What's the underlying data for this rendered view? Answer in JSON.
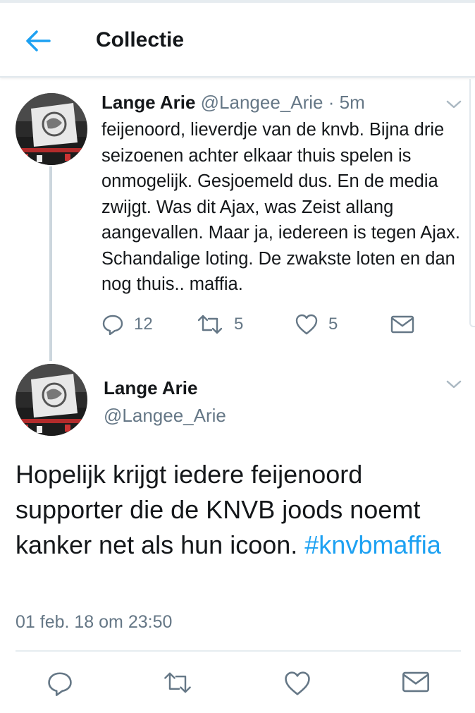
{
  "header": {
    "title": "Collectie",
    "back_icon": "arrow-left-icon",
    "accent_color": "#1da1f2"
  },
  "reply_tweet": {
    "name": "Lange Arie",
    "handle": "@Langee_Arie",
    "separator": "·",
    "time": "5m",
    "text": "feijenoord, lieverdje van de knvb. Bijna drie seizoenen achter elkaar thuis spelen is onmogelijk. Gesjoemeld dus. En de media zwijgt. Was dit Ajax, was Zeist allang aangevallen. Maar ja, iedereen is tegen Ajax. Schandalige loting. De zwakste loten en dan nog thuis.. maffia.",
    "replies": "12",
    "retweets": "5",
    "likes": "5"
  },
  "main_tweet": {
    "name": "Lange Arie",
    "handle": "@Langee_Arie",
    "text": "Hopelijk krijgt iedere feijenoord supporter die de KNVB joods noemt kanker net als hun icoon.",
    "hashtag": "#knvbmaffia",
    "timestamp": "01 feb. 18 om 23:50"
  },
  "colors": {
    "text": "#14171a",
    "muted": "#657786",
    "link": "#1da1f2",
    "divider": "#e6ecf0"
  }
}
